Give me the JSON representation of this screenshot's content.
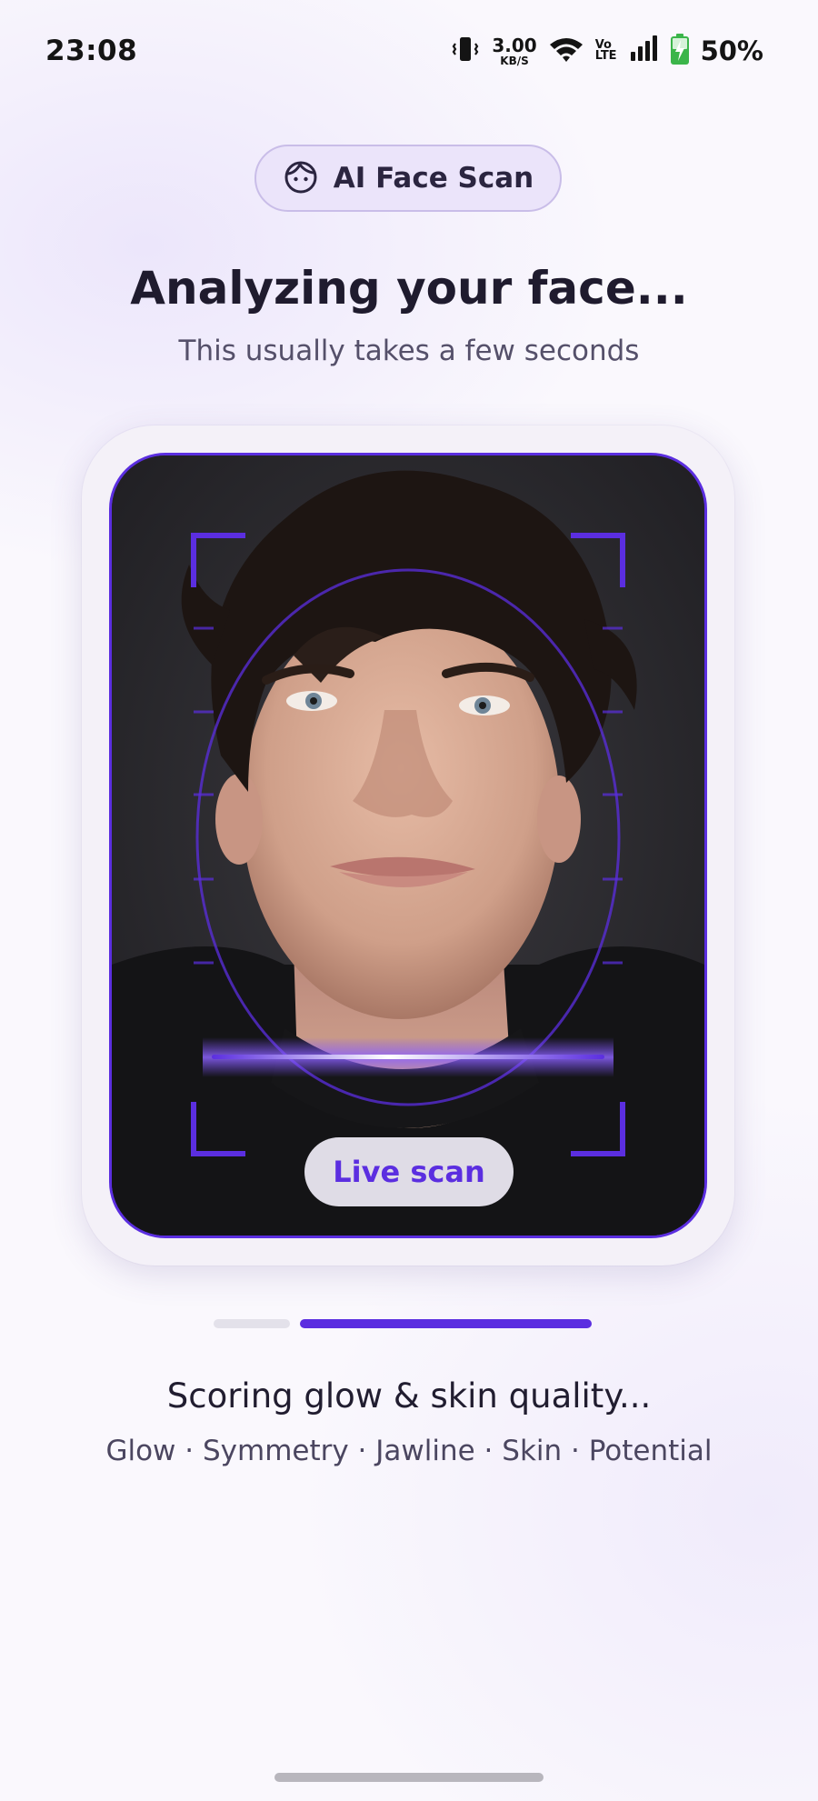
{
  "status_bar": {
    "time": "23:08",
    "net_speed_value": "3.00",
    "net_speed_unit": "KB/S",
    "volte_top": "Vo",
    "volte_bottom": "LTE",
    "battery_percent": "50%",
    "icons": [
      "vibrate-icon",
      "wifi-icon",
      "signal-icon",
      "battery-charging-icon"
    ]
  },
  "header": {
    "pill_label": "AI Face Scan",
    "pill_icon": "face-icon",
    "title": "Analyzing your face...",
    "subtitle": "This usually takes a few seconds"
  },
  "scan": {
    "live_label": "Live scan",
    "accent_color": "#5b2ee0"
  },
  "progress": {
    "total_steps": 2,
    "current_step": 2,
    "active_color": "#5b2ee0",
    "inactive_color": "#e3e1ea"
  },
  "status": {
    "step_label": "Scoring glow & skin quality...",
    "metrics": "Glow · Symmetry · Jawline · Skin · Potential"
  }
}
